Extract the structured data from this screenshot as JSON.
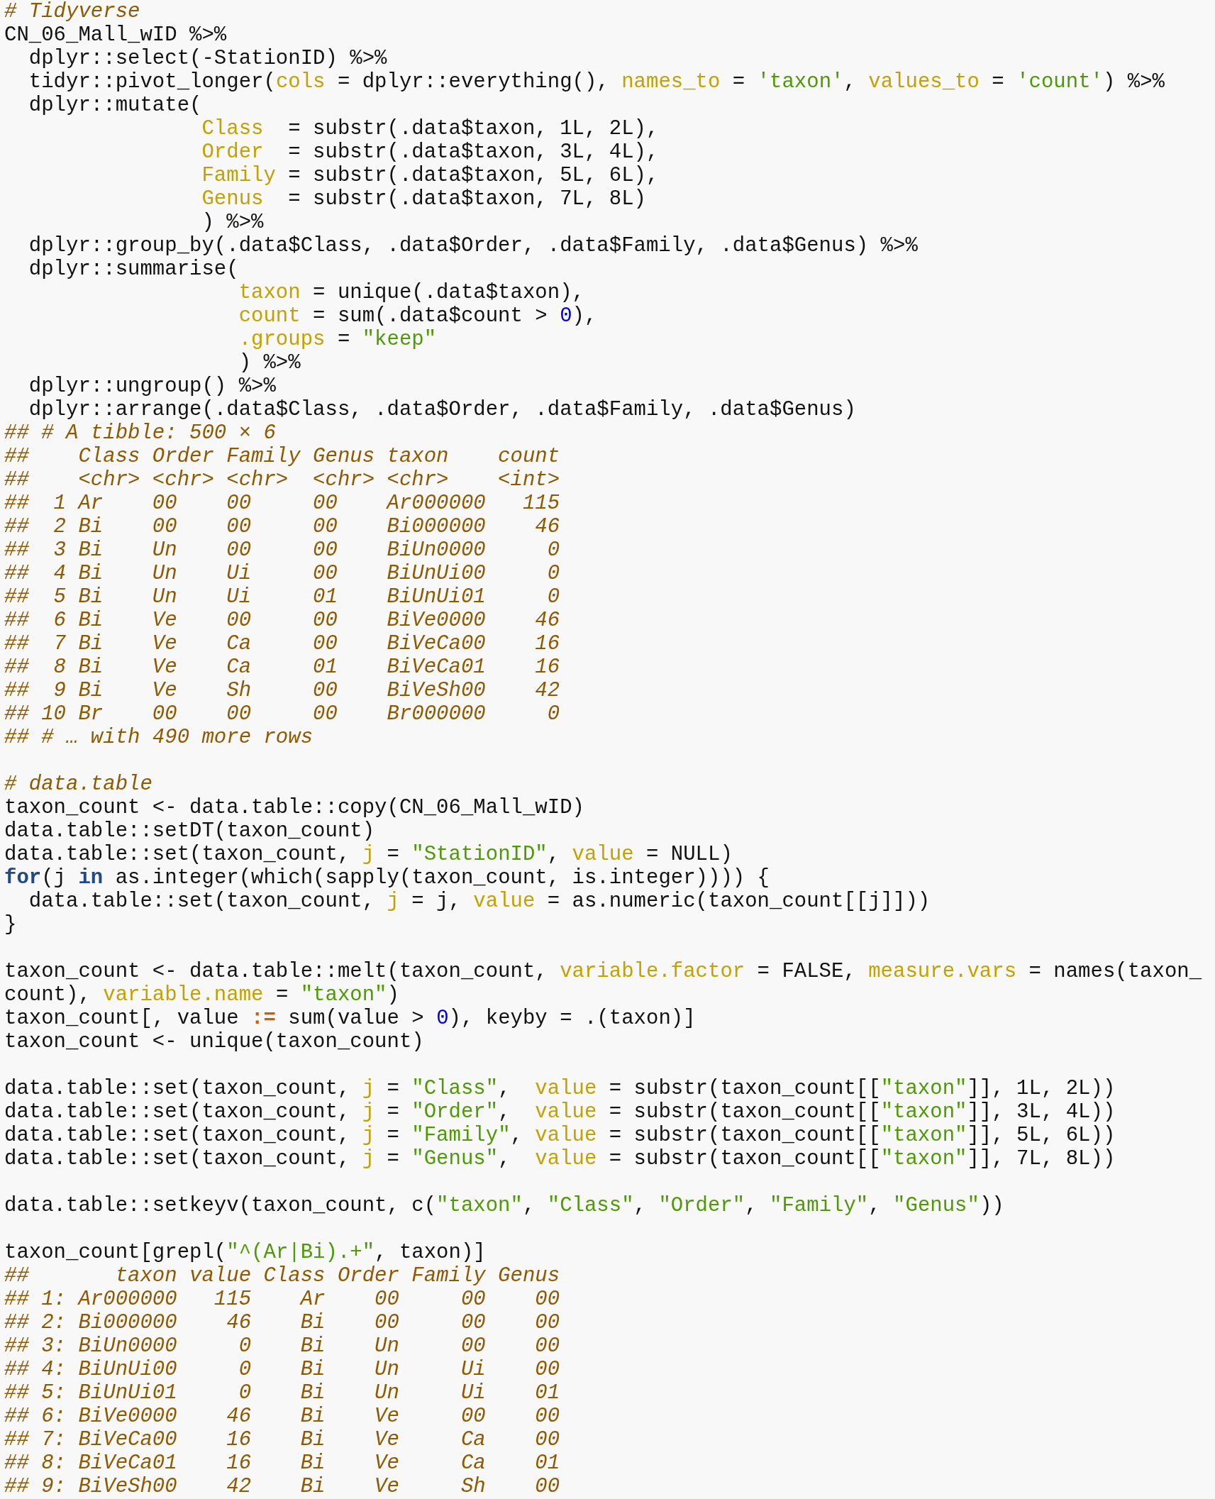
{
  "lines": [
    {
      "kind": "comment",
      "text": "# Tidyverse"
    },
    {
      "kind": "code",
      "tokens": [
        {
          "kind": "plain",
          "text": "CN_06_Mall_wID %>%"
        }
      ]
    },
    {
      "kind": "code",
      "tokens": [
        {
          "kind": "plain",
          "text": "  dplyr::select(-StationID) %>%"
        }
      ]
    },
    {
      "kind": "code",
      "tokens": [
        {
          "kind": "plain",
          "text": "  tidyr::pivot_longer("
        },
        {
          "kind": "arg",
          "text": "cols"
        },
        {
          "kind": "plain",
          "text": " = dplyr::everything(), "
        },
        {
          "kind": "arg",
          "text": "names_to"
        },
        {
          "kind": "plain",
          "text": " = "
        },
        {
          "kind": "string",
          "text": "'taxon'"
        },
        {
          "kind": "plain",
          "text": ", "
        },
        {
          "kind": "arg",
          "text": "values_to"
        },
        {
          "kind": "plain",
          "text": " = "
        },
        {
          "kind": "string",
          "text": "'count'"
        },
        {
          "kind": "plain",
          "text": ") %>%"
        }
      ]
    },
    {
      "kind": "code",
      "tokens": [
        {
          "kind": "plain",
          "text": "  dplyr::mutate("
        }
      ]
    },
    {
      "kind": "code",
      "tokens": [
        {
          "kind": "arg",
          "text": "                Class"
        },
        {
          "kind": "plain",
          "text": "  = substr(.data$taxon, 1L, 2L),"
        }
      ]
    },
    {
      "kind": "code",
      "tokens": [
        {
          "kind": "arg",
          "text": "                Order"
        },
        {
          "kind": "plain",
          "text": "  = substr(.data$taxon, 3L, 4L),"
        }
      ]
    },
    {
      "kind": "code",
      "tokens": [
        {
          "kind": "arg",
          "text": "                Family"
        },
        {
          "kind": "plain",
          "text": " = substr(.data$taxon, 5L, 6L),"
        }
      ]
    },
    {
      "kind": "code",
      "tokens": [
        {
          "kind": "arg",
          "text": "                Genus"
        },
        {
          "kind": "plain",
          "text": "  = substr(.data$taxon, 7L, 8L)"
        }
      ]
    },
    {
      "kind": "code",
      "tokens": [
        {
          "kind": "plain",
          "text": "                ) %>%"
        }
      ]
    },
    {
      "kind": "code",
      "tokens": [
        {
          "kind": "plain",
          "text": "  dplyr::group_by(.data$Class, .data$Order, .data$Family, .data$Genus) %>%"
        }
      ]
    },
    {
      "kind": "code",
      "tokens": [
        {
          "kind": "plain",
          "text": "  dplyr::summarise("
        }
      ]
    },
    {
      "kind": "code",
      "tokens": [
        {
          "kind": "arg",
          "text": "                   taxon"
        },
        {
          "kind": "plain",
          "text": " = unique(.data$taxon),"
        }
      ]
    },
    {
      "kind": "code",
      "tokens": [
        {
          "kind": "arg",
          "text": "                   count"
        },
        {
          "kind": "plain",
          "text": " = sum(.data$count > "
        },
        {
          "kind": "number",
          "text": "0"
        },
        {
          "kind": "plain",
          "text": "),"
        }
      ]
    },
    {
      "kind": "code",
      "tokens": [
        {
          "kind": "arg",
          "text": "                   .groups"
        },
        {
          "kind": "plain",
          "text": " = "
        },
        {
          "kind": "string",
          "text": "\"keep\""
        }
      ]
    },
    {
      "kind": "code",
      "tokens": [
        {
          "kind": "plain",
          "text": "                   ) %>%"
        }
      ]
    },
    {
      "kind": "code",
      "tokens": [
        {
          "kind": "plain",
          "text": "  dplyr::ungroup() %>%"
        }
      ]
    },
    {
      "kind": "code",
      "tokens": [
        {
          "kind": "plain",
          "text": "  dplyr::arrange(.data$Class, .data$Order, .data$Family, .data$Genus)"
        }
      ]
    },
    {
      "kind": "comment",
      "text": "## # A tibble: 500 × 6"
    },
    {
      "kind": "comment",
      "text": "##    Class Order Family Genus taxon    count"
    },
    {
      "kind": "comment",
      "text": "##    <chr> <chr> <chr>  <chr> <chr>    <int>"
    },
    {
      "kind": "comment",
      "text": "##  1 Ar    00    00     00    Ar000000   115"
    },
    {
      "kind": "comment",
      "text": "##  2 Bi    00    00     00    Bi000000    46"
    },
    {
      "kind": "comment",
      "text": "##  3 Bi    Un    00     00    BiUn0000     0"
    },
    {
      "kind": "comment",
      "text": "##  4 Bi    Un    Ui     00    BiUnUi00     0"
    },
    {
      "kind": "comment",
      "text": "##  5 Bi    Un    Ui     01    BiUnUi01     0"
    },
    {
      "kind": "comment",
      "text": "##  6 Bi    Ve    00     00    BiVe0000    46"
    },
    {
      "kind": "comment",
      "text": "##  7 Bi    Ve    Ca     00    BiVeCa00    16"
    },
    {
      "kind": "comment",
      "text": "##  8 Bi    Ve    Ca     01    BiVeCa01    16"
    },
    {
      "kind": "comment",
      "text": "##  9 Bi    Ve    Sh     00    BiVeSh00    42"
    },
    {
      "kind": "comment",
      "text": "## 10 Br    00    00     00    Br000000     0"
    },
    {
      "kind": "comment",
      "text": "## # … with 490 more rows"
    },
    {
      "kind": "blank"
    },
    {
      "kind": "comment",
      "text": "# data.table"
    },
    {
      "kind": "code",
      "tokens": [
        {
          "kind": "plain",
          "text": "taxon_count <- data.table::copy(CN_06_Mall_wID)"
        }
      ]
    },
    {
      "kind": "code",
      "tokens": [
        {
          "kind": "plain",
          "text": "data.table::setDT(taxon_count)"
        }
      ]
    },
    {
      "kind": "code",
      "tokens": [
        {
          "kind": "plain",
          "text": "data.table::set(taxon_count, "
        },
        {
          "kind": "arg",
          "text": "j"
        },
        {
          "kind": "plain",
          "text": " = "
        },
        {
          "kind": "string",
          "text": "\"StationID\""
        },
        {
          "kind": "plain",
          "text": ", "
        },
        {
          "kind": "arg",
          "text": "value"
        },
        {
          "kind": "plain",
          "text": " = NULL)"
        }
      ]
    },
    {
      "kind": "code",
      "tokens": [
        {
          "kind": "keyword",
          "text": "for"
        },
        {
          "kind": "plain",
          "text": "(j "
        },
        {
          "kind": "keyword",
          "text": "in"
        },
        {
          "kind": "plain",
          "text": " as.integer(which(sapply(taxon_count, is.integer)))) {"
        }
      ]
    },
    {
      "kind": "code",
      "tokens": [
        {
          "kind": "plain",
          "text": "  data.table::set(taxon_count, "
        },
        {
          "kind": "arg",
          "text": "j"
        },
        {
          "kind": "plain",
          "text": " = j, "
        },
        {
          "kind": "arg",
          "text": "value"
        },
        {
          "kind": "plain",
          "text": " = as.numeric(taxon_count[[j]]))"
        }
      ]
    },
    {
      "kind": "code",
      "tokens": [
        {
          "kind": "plain",
          "text": "}"
        }
      ]
    },
    {
      "kind": "blank"
    },
    {
      "kind": "code",
      "tokens": [
        {
          "kind": "plain",
          "text": "taxon_count <- data.table::melt(taxon_count, "
        },
        {
          "kind": "arg",
          "text": "variable.factor"
        },
        {
          "kind": "plain",
          "text": " = FALSE, "
        },
        {
          "kind": "arg",
          "text": "measure.vars"
        },
        {
          "kind": "plain",
          "text": " = names(taxon_"
        }
      ]
    },
    {
      "kind": "code",
      "tokens": [
        {
          "kind": "plain",
          "text": "count), "
        },
        {
          "kind": "arg",
          "text": "variable.name"
        },
        {
          "kind": "plain",
          "text": " = "
        },
        {
          "kind": "string",
          "text": "\"taxon\""
        },
        {
          "kind": "plain",
          "text": ")"
        }
      ]
    },
    {
      "kind": "code",
      "tokens": [
        {
          "kind": "plain",
          "text": "taxon_count[, value "
        },
        {
          "kind": "operator",
          "text": ":="
        },
        {
          "kind": "plain",
          "text": " sum(value > "
        },
        {
          "kind": "number",
          "text": "0"
        },
        {
          "kind": "plain",
          "text": "), keyby = .(taxon)]"
        }
      ]
    },
    {
      "kind": "code",
      "tokens": [
        {
          "kind": "plain",
          "text": "taxon_count <- unique(taxon_count)"
        }
      ]
    },
    {
      "kind": "blank"
    },
    {
      "kind": "code",
      "tokens": [
        {
          "kind": "plain",
          "text": "data.table::set(taxon_count, "
        },
        {
          "kind": "arg",
          "text": "j"
        },
        {
          "kind": "plain",
          "text": " = "
        },
        {
          "kind": "string",
          "text": "\"Class\""
        },
        {
          "kind": "plain",
          "text": ",  "
        },
        {
          "kind": "arg",
          "text": "value"
        },
        {
          "kind": "plain",
          "text": " = substr(taxon_count[["
        },
        {
          "kind": "string",
          "text": "\"taxon\""
        },
        {
          "kind": "plain",
          "text": "]], 1L, 2L))"
        }
      ]
    },
    {
      "kind": "code",
      "tokens": [
        {
          "kind": "plain",
          "text": "data.table::set(taxon_count, "
        },
        {
          "kind": "arg",
          "text": "j"
        },
        {
          "kind": "plain",
          "text": " = "
        },
        {
          "kind": "string",
          "text": "\"Order\""
        },
        {
          "kind": "plain",
          "text": ",  "
        },
        {
          "kind": "arg",
          "text": "value"
        },
        {
          "kind": "plain",
          "text": " = substr(taxon_count[["
        },
        {
          "kind": "string",
          "text": "\"taxon\""
        },
        {
          "kind": "plain",
          "text": "]], 3L, 4L))"
        }
      ]
    },
    {
      "kind": "code",
      "tokens": [
        {
          "kind": "plain",
          "text": "data.table::set(taxon_count, "
        },
        {
          "kind": "arg",
          "text": "j"
        },
        {
          "kind": "plain",
          "text": " = "
        },
        {
          "kind": "string",
          "text": "\"Family\""
        },
        {
          "kind": "plain",
          "text": ", "
        },
        {
          "kind": "arg",
          "text": "value"
        },
        {
          "kind": "plain",
          "text": " = substr(taxon_count[["
        },
        {
          "kind": "string",
          "text": "\"taxon\""
        },
        {
          "kind": "plain",
          "text": "]], 5L, 6L))"
        }
      ]
    },
    {
      "kind": "code",
      "tokens": [
        {
          "kind": "plain",
          "text": "data.table::set(taxon_count, "
        },
        {
          "kind": "arg",
          "text": "j"
        },
        {
          "kind": "plain",
          "text": " = "
        },
        {
          "kind": "string",
          "text": "\"Genus\""
        },
        {
          "kind": "plain",
          "text": ",  "
        },
        {
          "kind": "arg",
          "text": "value"
        },
        {
          "kind": "plain",
          "text": " = substr(taxon_count[["
        },
        {
          "kind": "string",
          "text": "\"taxon\""
        },
        {
          "kind": "plain",
          "text": "]], 7L, 8L))"
        }
      ]
    },
    {
      "kind": "blank"
    },
    {
      "kind": "code",
      "tokens": [
        {
          "kind": "plain",
          "text": "data.table::setkeyv(taxon_count, c("
        },
        {
          "kind": "string",
          "text": "\"taxon\""
        },
        {
          "kind": "plain",
          "text": ", "
        },
        {
          "kind": "string",
          "text": "\"Class\""
        },
        {
          "kind": "plain",
          "text": ", "
        },
        {
          "kind": "string",
          "text": "\"Order\""
        },
        {
          "kind": "plain",
          "text": ", "
        },
        {
          "kind": "string",
          "text": "\"Family\""
        },
        {
          "kind": "plain",
          "text": ", "
        },
        {
          "kind": "string",
          "text": "\"Genus\""
        },
        {
          "kind": "plain",
          "text": "))"
        }
      ]
    },
    {
      "kind": "blank"
    },
    {
      "kind": "code",
      "tokens": [
        {
          "kind": "plain",
          "text": "taxon_count[grepl("
        },
        {
          "kind": "string",
          "text": "\"^(Ar|Bi).+\""
        },
        {
          "kind": "plain",
          "text": ", taxon)]"
        }
      ]
    },
    {
      "kind": "comment",
      "text": "##       taxon value Class Order Family Genus"
    },
    {
      "kind": "comment",
      "text": "## 1: Ar000000   115    Ar    00     00    00"
    },
    {
      "kind": "comment",
      "text": "## 2: Bi000000    46    Bi    00     00    00"
    },
    {
      "kind": "comment",
      "text": "## 3: BiUn0000     0    Bi    Un     00    00"
    },
    {
      "kind": "comment",
      "text": "## 4: BiUnUi00     0    Bi    Un     Ui    00"
    },
    {
      "kind": "comment",
      "text": "## 5: BiUnUi01     0    Bi    Un     Ui    01"
    },
    {
      "kind": "comment",
      "text": "## 6: BiVe0000    46    Bi    Ve     00    00"
    },
    {
      "kind": "comment",
      "text": "## 7: BiVeCa00    16    Bi    Ve     Ca    00"
    },
    {
      "kind": "comment",
      "text": "## 8: BiVeCa01    16    Bi    Ve     Ca    01"
    },
    {
      "kind": "comment",
      "text": "## 9: BiVeSh00    42    Bi    Ve     Sh    00"
    }
  ]
}
